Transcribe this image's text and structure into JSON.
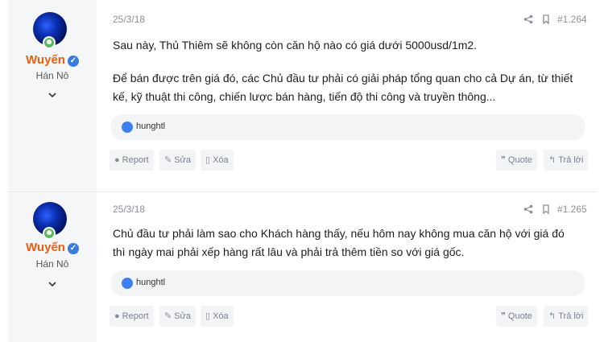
{
  "posts": [
    {
      "username": "Wuyến",
      "user_title": "Hán Nô",
      "date": "25/3/18",
      "post_number": "#1.264",
      "body_lines": [
        "Sau này, Thủ Thiêm sẽ không còn căn hộ nào có giá dưới 5000usd/1m2.",
        "",
        "Để bán được trên giá đó, các Chủ đầu tư phải có giải pháp tổng quan cho cả Dự án, từ thiết",
        "kế, kỹ thuật thi công, chiến lược bán hàng, tiến độ thi công và truyền thông..."
      ],
      "reactor": "hunghtl"
    },
    {
      "username": "Wuyến",
      "user_title": "Hán Nô",
      "date": "25/3/18",
      "post_number": "#1.265",
      "body_lines": [
        "Chủ đầu tư phải làm sao cho Khách hàng thấy, nếu hôm nay không mua căn hộ với giá đó",
        "thì ngày mai phải xếp hàng rất lâu và phải trả thêm tiền so với giá gốc."
      ],
      "reactor": "hunghtl"
    }
  ],
  "actions": {
    "report": "Report",
    "edit": "Sửa",
    "delete": "Xóa",
    "quote": "Quote",
    "reply": "Trả lời"
  },
  "colors": {
    "username": "#e95f12",
    "accent": "#3d7ef0",
    "online": "#5bb85d"
  }
}
